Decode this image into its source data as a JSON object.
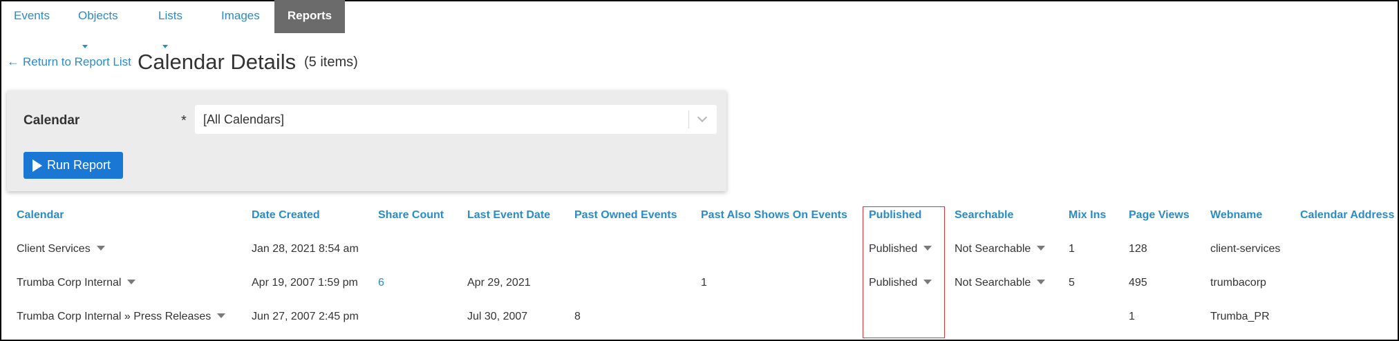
{
  "nav": {
    "items": [
      {
        "label": "Events"
      },
      {
        "label": "Objects"
      },
      {
        "label": "Lists"
      },
      {
        "label": "Images"
      },
      {
        "label": "Reports"
      }
    ]
  },
  "header": {
    "back_label": "Return to Report List",
    "title": "Calendar Details",
    "count": "(5 items)"
  },
  "filter": {
    "label": "Calendar",
    "required_mark": "*",
    "select_value": "[All Calendars]",
    "run_label": "Run Report"
  },
  "table": {
    "columns": [
      "Calendar",
      "Date Created",
      "Share Count",
      "Last Event Date",
      "Past Owned Events",
      "Past Also Shows On Events",
      "Published",
      "Searchable",
      "Mix Ins",
      "Page Views",
      "Webname",
      "Calendar Address"
    ],
    "rows": [
      {
        "calendar": "Client Services",
        "date_created": "Jan 28, 2021 8:54 am",
        "share_count": "",
        "last_event_date": "",
        "past_owned_events": "",
        "past_also_shows": "",
        "published": "Published",
        "searchable": "Not Searchable",
        "mix_ins": "1",
        "page_views": "128",
        "webname": "client-services"
      },
      {
        "calendar": "Trumba Corp Internal",
        "date_created": "Apr 19, 2007 1:59 pm",
        "share_count": "6",
        "last_event_date": "Apr 29, 2021",
        "past_owned_events": "",
        "past_also_shows": "1",
        "published": "Published",
        "searchable": "Not Searchable",
        "mix_ins": "5",
        "page_views": "495",
        "webname": "trumbacorp"
      },
      {
        "calendar": "Trumba Corp Internal » Press Releases",
        "date_created": "Jun 27, 2007 2:45 pm",
        "share_count": "",
        "last_event_date": "Jul 30, 2007",
        "past_owned_events": "8",
        "past_also_shows": "",
        "published": "",
        "searchable": "",
        "mix_ins": "",
        "page_views": "1",
        "webname": "Trumba_PR"
      }
    ]
  },
  "colors": {
    "link": "#2a8cc7",
    "active_tab": "#6b6b6b",
    "button": "#1a78d4",
    "highlight": "#e03030"
  }
}
